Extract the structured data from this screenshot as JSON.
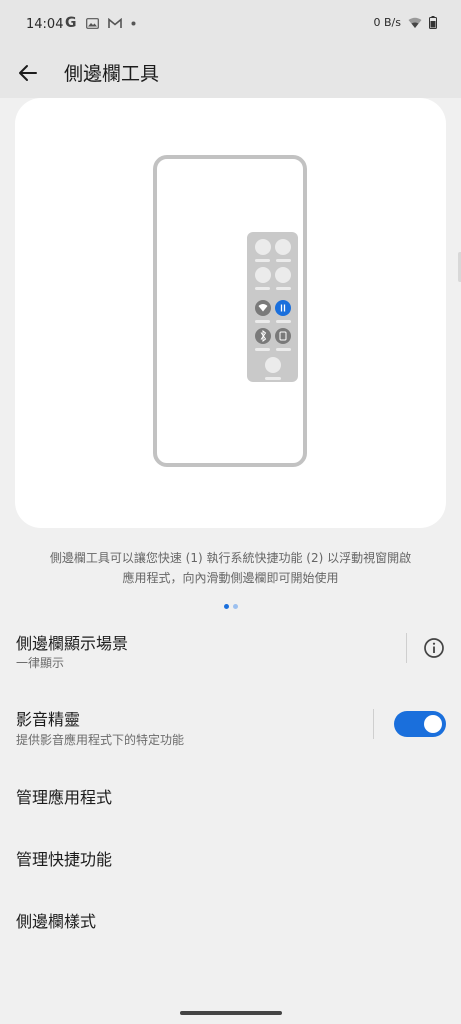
{
  "status_bar": {
    "time": "14:04",
    "left_icons": [
      "google-icon",
      "gallery-icon",
      "gmail-icon",
      "dot-icon"
    ],
    "net_speed": "0 B/s",
    "right_icons": [
      "wifi-icon",
      "battery-icon"
    ]
  },
  "app_bar": {
    "title": "側邊欄工具"
  },
  "description": {
    "line1": "側邊欄工具可以讓您快速 (1) 執行系統快捷功能 (2) 以浮動視窗開啟",
    "line2": "應用程式，向內滑動側邊欄即可開始使用"
  },
  "pager": {
    "pages": 2,
    "current": 1
  },
  "settings": {
    "display_scene": {
      "title": "側邊欄顯示場景",
      "subtitle": "一律顯示"
    },
    "game_genie": {
      "title": "影音精靈",
      "subtitle": "提供影音應用程式下的特定功能",
      "enabled": true
    },
    "manage_apps": {
      "title": "管理應用程式"
    },
    "manage_shortcuts": {
      "title": "管理快捷功能"
    },
    "sidebar_style": {
      "title": "側邊欄樣式"
    }
  },
  "colors": {
    "accent": "#1a6fdc",
    "background": "#f0f0f0",
    "card": "#ffffff"
  }
}
